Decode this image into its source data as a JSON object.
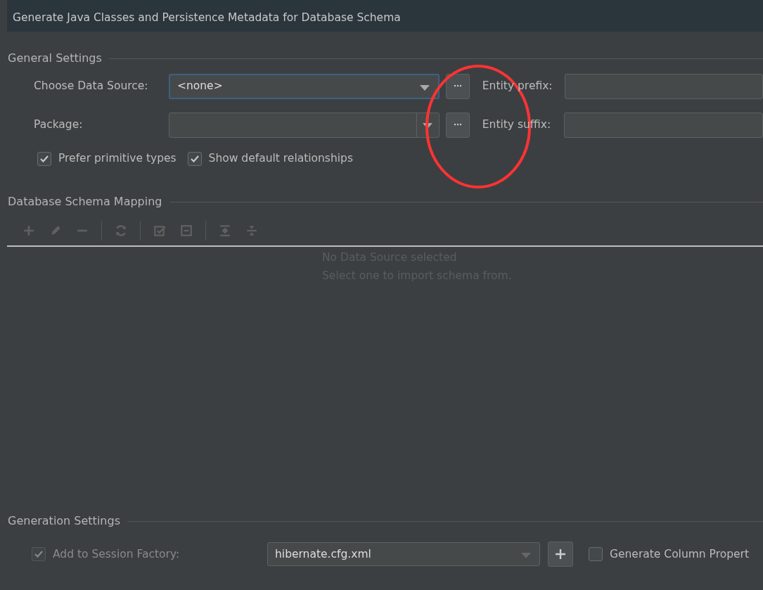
{
  "header": {
    "subtitle": "Generate Java Classes and Persistence Metadata for Database Schema"
  },
  "general_settings": {
    "title": "General Settings",
    "rows": [
      {
        "label": "Choose Data Source:",
        "combo": {
          "kind": "select",
          "value": "<none>",
          "focused": true
        },
        "side_label": "Entity prefix:"
      },
      {
        "label": "Package:",
        "combo": {
          "kind": "editable",
          "focused": false
        },
        "side_label": "Entity suffix:"
      }
    ],
    "checkboxes": [
      {
        "label": "Prefer primitive types",
        "checked": true
      },
      {
        "label": "Show default relationships",
        "checked": true
      }
    ]
  },
  "schema_mapping": {
    "title": "Database Schema Mapping",
    "toolbar": [
      {
        "kind": "button",
        "disabled": true
      },
      {
        "kind": "button",
        "disabled": true
      },
      {
        "kind": "button",
        "disabled": true
      },
      {
        "kind": "separator"
      },
      {
        "kind": "button",
        "disabled": true
      },
      {
        "kind": "separator"
      },
      {
        "kind": "button",
        "disabled": true
      },
      {
        "kind": "button",
        "disabled": true
      },
      {
        "kind": "separator"
      },
      {
        "kind": "button",
        "disabled": true
      },
      {
        "kind": "button",
        "disabled": true
      }
    ],
    "empty_message": [
      "No Data Source selected",
      "Select one to import schema from."
    ]
  },
  "generation_settings": {
    "title": "Generation Settings",
    "rows": [
      {
        "label": "Add to Session Factory:",
        "checked": true,
        "disabled": true,
        "combo": "hibernate.cfg.xml",
        "side_checkbox": {
          "label": "Generate Column Propert",
          "checked": false
        }
      }
    ]
  },
  "annotation": {
    "kind": "ellipse",
    "color": "#ff3333"
  }
}
